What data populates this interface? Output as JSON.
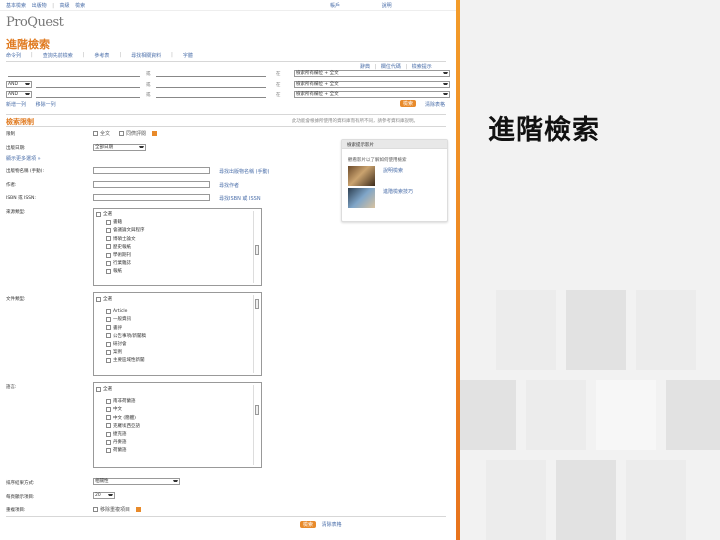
{
  "topbar": {
    "left_links": [
      "基本檢索",
      "出版物",
      "|",
      "高級",
      "檢索"
    ],
    "right_links": [
      "帳戶",
      "說明"
    ],
    "accent": "#e07b21",
    "link_color": "#4a6ea9"
  },
  "logo": {
    "text": "ProQuest"
  },
  "page_title": "進階檢索",
  "tabs": [
    "命令列",
    "|",
    "查詢先前檢索",
    "|",
    "參考表",
    "|",
    "尋找相關資料",
    "|",
    "字體"
  ],
  "tools_right": [
    "辭典",
    "|",
    "欄位代碼",
    "|",
    "檢索提示"
  ],
  "search_rows": [
    {
      "op": "",
      "in_field": "檢索所有欄位 + 全文",
      "or_label": "或",
      "in_label": "在"
    },
    {
      "op": "AND",
      "in_field": "檢索所有欄位 + 全文",
      "or_label": "或",
      "in_label": "在"
    },
    {
      "op": "AND",
      "in_field": "檢索所有欄位 + 全文",
      "or_label": "或",
      "in_label": "在"
    }
  ],
  "row_actions": {
    "add_row": "新增一列",
    "remove_row": "移除一列",
    "search_button": "檢索",
    "clear": "清除表格"
  },
  "section_title": "檢索限制",
  "section_note": "此功能會根據所使用的資料庫而有所不同，請參考資料庫說明。",
  "limits": {
    "full_text_label": "限制",
    "full_text_option": "全文",
    "peer_reviewed_option": "同儕評閱",
    "date_label": "出版日期:",
    "date_value": "全部日期",
    "more_options_link": "顯示更多選項 »",
    "pub_title_label": "出版物名稱 (手動):",
    "pub_title_link": "尋找出版物名稱 (手動)",
    "author_label": "作者:",
    "author_link": "尋找作者",
    "isbn_label": "ISBN 或 ISSN:",
    "isbn_link": "尋找ISBN 或 ISSN",
    "source_type_label": "來源類型:",
    "doc_type_label": "文件類型:",
    "language_label": "語言:",
    "sort_label": "排序結果方式:",
    "sort_value": "相關性",
    "per_page_label": "每頁顯示項目:",
    "per_page_value": "20",
    "duplicates_label": "重複項目:",
    "duplicates_option": "移除重複項目"
  },
  "source_types": [
    "全選",
    "書籍",
    "會議論文與程序",
    "博碩士論文",
    "歷史報紙",
    "學術期刊",
    "行業雜誌",
    "報紙"
  ],
  "doc_types": [
    "全選",
    "Article",
    "一般資訊",
    "書評",
    "公告事項/新聞稿",
    "研討會",
    "案例",
    "主要區域性新聞"
  ],
  "languages": [
    "全選",
    "南非荷蘭語",
    "中文",
    "中文 (簡體)",
    "克羅埃西亞語",
    "捷克語",
    "丹麥語",
    "荷蘭語"
  ],
  "sidebox": {
    "title": "檢索提示影片",
    "desc": "觀看影片以了解如何使用檢索",
    "items": [
      "說明檢索",
      "進階檢索技巧"
    ]
  },
  "bottom": {
    "search_button": "檢索",
    "clear": "清除表格"
  },
  "slide": {
    "title": "進階檢索",
    "title_color": "#111111",
    "accent": "#e88a2a"
  }
}
